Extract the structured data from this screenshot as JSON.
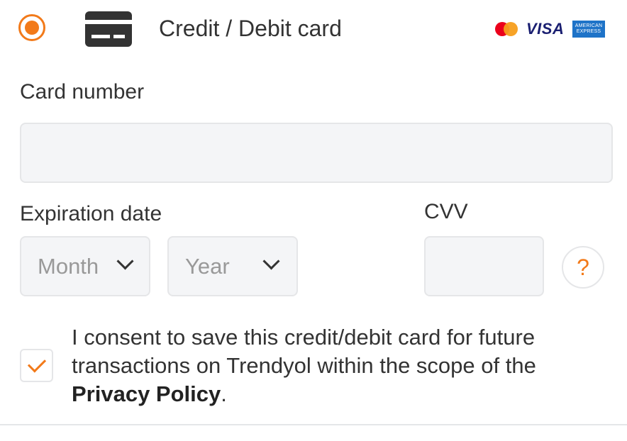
{
  "payment_method": {
    "title": "Credit / Debit card",
    "selected": true,
    "brand_icons": [
      "mastercard-icon",
      "visa-icon",
      "amex-icon"
    ],
    "visa_text": "VISA",
    "amex_text_line1": "AMERICAN",
    "amex_text_line2": "EXPRESS"
  },
  "form": {
    "card_number_label": "Card number",
    "card_number_value": "",
    "expiration_label": "Expiration date",
    "month_placeholder": "Month",
    "year_placeholder": "Year",
    "cvv_label": "CVV",
    "cvv_value": "",
    "help_symbol": "?"
  },
  "consent": {
    "checked": true,
    "text_before": "I consent to save this credit/debit card for future transactions on Trendyol within the scope of the ",
    "link_text": "Privacy Policy",
    "text_after": "."
  },
  "colors": {
    "accent": "#f27a1a",
    "input_bg": "#f4f5f7",
    "border": "#e5e6e8"
  }
}
